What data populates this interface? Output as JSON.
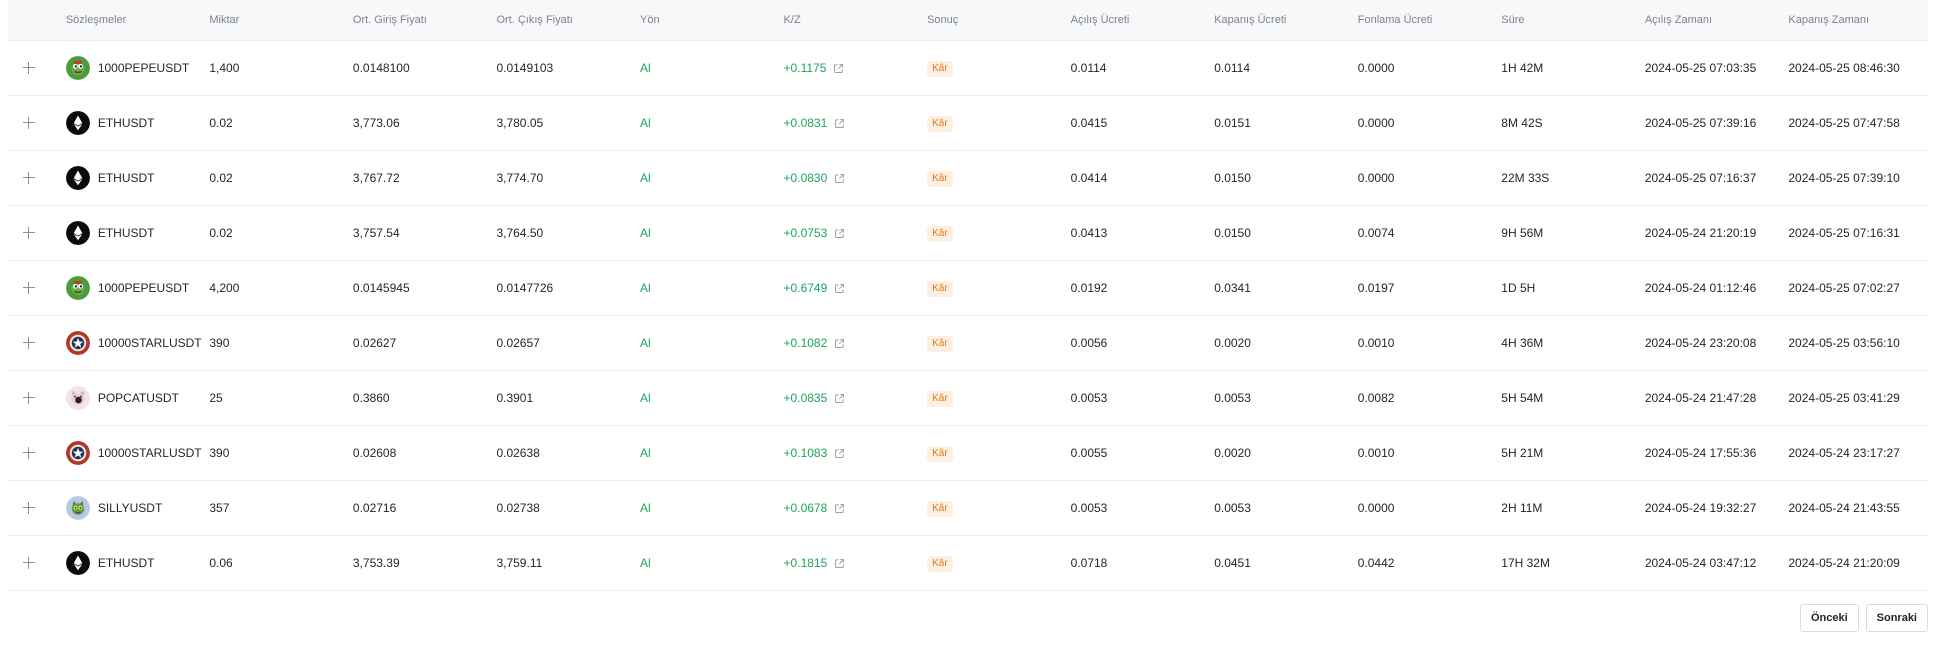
{
  "table": {
    "headers": {
      "contracts": "Sözleşmeler",
      "quantity": "Miktar",
      "avg_entry": "Ort. Giriş Fiyatı",
      "avg_exit": "Ort. Çıkış Fiyatı",
      "side": "Yön",
      "pnl": "K/Z",
      "result": "Sonuç",
      "open_fee": "Açılış Ücreti",
      "close_fee": "Kapanış Ücreti",
      "funding_fee": "Fonlama Ücreti",
      "duration": "Süre",
      "open_time": "Açılış Zamanı",
      "close_time": "Kapanış Zamanı"
    },
    "rows": [
      {
        "icon": "pepe",
        "symbol": "1000PEPEUSDT",
        "qty": "1,400",
        "entry": "0.0148100",
        "exit": "0.0149103",
        "side": "Al",
        "pnl": "+0.1175",
        "result": "Kâr",
        "open_fee": "0.0114",
        "close_fee": "0.0114",
        "funding_fee": "0.0000",
        "duration": "1H 42M",
        "open_time": "2024-05-25 07:03:35",
        "close_time": "2024-05-25 08:46:30"
      },
      {
        "icon": "eth",
        "symbol": "ETHUSDT",
        "qty": "0.02",
        "entry": "3,773.06",
        "exit": "3,780.05",
        "side": "Al",
        "pnl": "+0.0831",
        "result": "Kâr",
        "open_fee": "0.0415",
        "close_fee": "0.0151",
        "funding_fee": "0.0000",
        "duration": "8M 42S",
        "open_time": "2024-05-25 07:39:16",
        "close_time": "2024-05-25 07:47:58"
      },
      {
        "icon": "eth",
        "symbol": "ETHUSDT",
        "qty": "0.02",
        "entry": "3,767.72",
        "exit": "3,774.70",
        "side": "Al",
        "pnl": "+0.0830",
        "result": "Kâr",
        "open_fee": "0.0414",
        "close_fee": "0.0150",
        "funding_fee": "0.0000",
        "duration": "22M 33S",
        "open_time": "2024-05-25 07:16:37",
        "close_time": "2024-05-25 07:39:10"
      },
      {
        "icon": "eth",
        "symbol": "ETHUSDT",
        "qty": "0.02",
        "entry": "3,757.54",
        "exit": "3,764.50",
        "side": "Al",
        "pnl": "+0.0753",
        "result": "Kâr",
        "open_fee": "0.0413",
        "close_fee": "0.0150",
        "funding_fee": "0.0074",
        "duration": "9H 56M",
        "open_time": "2024-05-24 21:20:19",
        "close_time": "2024-05-25 07:16:31"
      },
      {
        "icon": "pepe",
        "symbol": "1000PEPEUSDT",
        "qty": "4,200",
        "entry": "0.0145945",
        "exit": "0.0147726",
        "side": "Al",
        "pnl": "+0.6749",
        "result": "Kâr",
        "open_fee": "0.0192",
        "close_fee": "0.0341",
        "funding_fee": "0.0197",
        "duration": "1D 5H",
        "open_time": "2024-05-24 01:12:46",
        "close_time": "2024-05-25 07:02:27"
      },
      {
        "icon": "starl",
        "symbol": "10000STARLUSDT",
        "qty": "390",
        "entry": "0.02627",
        "exit": "0.02657",
        "side": "Al",
        "pnl": "+0.1082",
        "result": "Kâr",
        "open_fee": "0.0056",
        "close_fee": "0.0020",
        "funding_fee": "0.0010",
        "duration": "4H 36M",
        "open_time": "2024-05-24 23:20:08",
        "close_time": "2024-05-25 03:56:10"
      },
      {
        "icon": "popcat",
        "symbol": "POPCATUSDT",
        "qty": "25",
        "entry": "0.3860",
        "exit": "0.3901",
        "side": "Al",
        "pnl": "+0.0835",
        "result": "Kâr",
        "open_fee": "0.0053",
        "close_fee": "0.0053",
        "funding_fee": "0.0082",
        "duration": "5H 54M",
        "open_time": "2024-05-24 21:47:28",
        "close_time": "2024-05-25 03:41:29"
      },
      {
        "icon": "starl",
        "symbol": "10000STARLUSDT",
        "qty": "390",
        "entry": "0.02608",
        "exit": "0.02638",
        "side": "Al",
        "pnl": "+0.1083",
        "result": "Kâr",
        "open_fee": "0.0055",
        "close_fee": "0.0020",
        "funding_fee": "0.0010",
        "duration": "5H 21M",
        "open_time": "2024-05-24 17:55:36",
        "close_time": "2024-05-24 23:17:27"
      },
      {
        "icon": "silly",
        "symbol": "SILLYUSDT",
        "qty": "357",
        "entry": "0.02716",
        "exit": "0.02738",
        "side": "Al",
        "pnl": "+0.0678",
        "result": "Kâr",
        "open_fee": "0.0053",
        "close_fee": "0.0053",
        "funding_fee": "0.0000",
        "duration": "2H 11M",
        "open_time": "2024-05-24 19:32:27",
        "close_time": "2024-05-24 21:43:55"
      },
      {
        "icon": "eth",
        "symbol": "ETHUSDT",
        "qty": "0.06",
        "entry": "3,753.39",
        "exit": "3,759.11",
        "side": "Al",
        "pnl": "+0.1815",
        "result": "Kâr",
        "open_fee": "0.0718",
        "close_fee": "0.0451",
        "funding_fee": "0.0442",
        "duration": "17H 32M",
        "open_time": "2024-05-24 03:47:12",
        "close_time": "2024-05-24 21:20:09"
      }
    ]
  },
  "pagination": {
    "prev_label": "Önceki",
    "next_label": "Sonraki"
  },
  "colors": {
    "buy": "#1fa35c",
    "profit_badge_text": "#e07a14",
    "profit_badge_bg": "#fdf0e2"
  }
}
